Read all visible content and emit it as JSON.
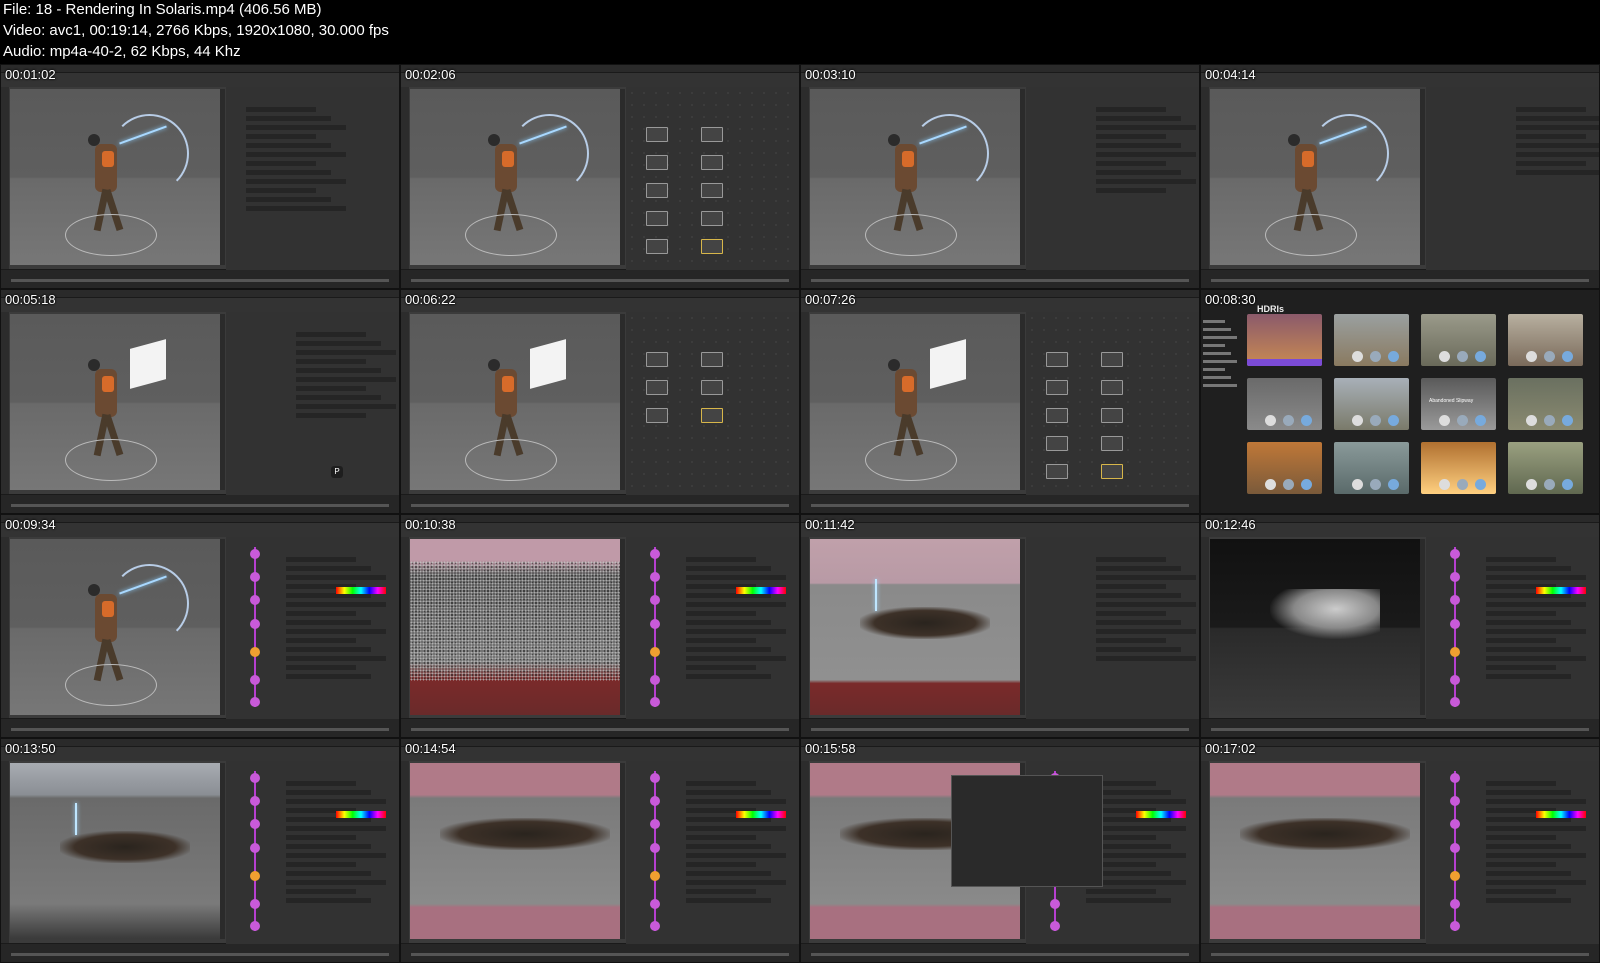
{
  "header": {
    "file_line": "File: 18 - Rendering In Solaris.mp4 (406.56 MB)",
    "video_line": "Video: avc1, 00:19:14, 2766 Kbps, 1920x1080, 30.000 fps",
    "audio_line": "Audio: mp4a-40-2, 62 Kbps, 44 Khz"
  },
  "thumbnails": [
    {
      "time": "00:01:02",
      "kind": "character-tree"
    },
    {
      "time": "00:02:06",
      "kind": "character-nodes"
    },
    {
      "time": "00:03:10",
      "kind": "character-params"
    },
    {
      "time": "00:04:14",
      "kind": "character-params2"
    },
    {
      "time": "00:05:18",
      "kind": "wire-params"
    },
    {
      "time": "00:06:22",
      "kind": "wire-network"
    },
    {
      "time": "00:07:26",
      "kind": "wire-nodes"
    },
    {
      "time": "00:08:30",
      "kind": "hdri",
      "hdri_title": "HDRIs",
      "hdri_label": "Abandoned Slipway"
    },
    {
      "time": "00:09:34",
      "kind": "character-stack"
    },
    {
      "time": "00:10:38",
      "kind": "noise-stack"
    },
    {
      "time": "00:11:42",
      "kind": "debris-params"
    },
    {
      "time": "00:12:46",
      "kind": "smoke-stack"
    },
    {
      "time": "00:13:50",
      "kind": "debris-stack"
    },
    {
      "time": "00:14:54",
      "kind": "pink-stack"
    },
    {
      "time": "00:15:58",
      "kind": "pink-dialog"
    },
    {
      "time": "00:17:02",
      "kind": "pink-stack2"
    }
  ],
  "badge": "P",
  "colors": {
    "accent": "#b63fd0",
    "node_highlight": "#d7b64a",
    "hdri_select": "#7b4bd6"
  }
}
